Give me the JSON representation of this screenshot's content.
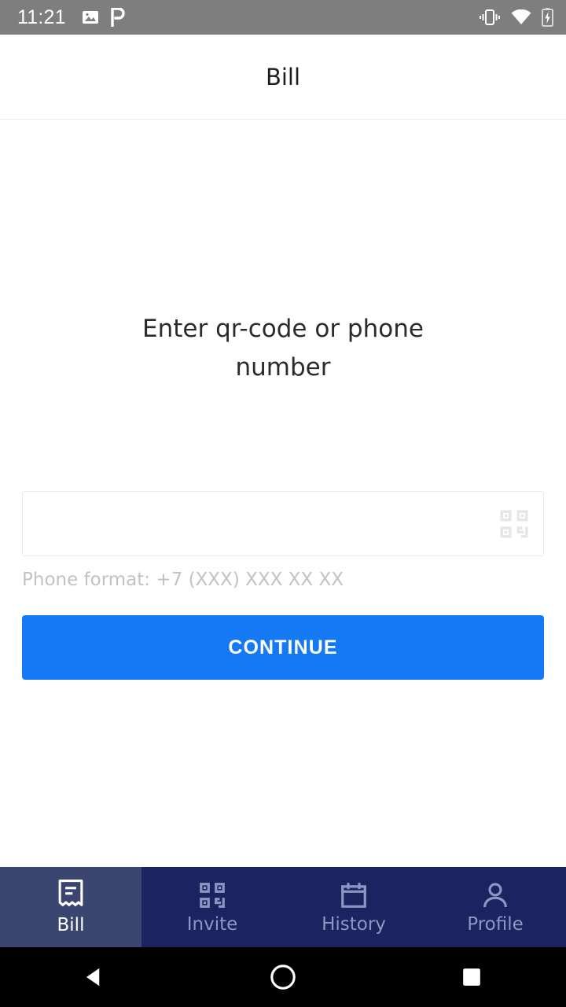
{
  "status_bar": {
    "time": "11:21",
    "left_icons": [
      {
        "name": "photo-icon"
      },
      {
        "name": "pocket-casts-icon"
      }
    ],
    "right_icons": [
      {
        "name": "vibrate-icon"
      },
      {
        "name": "wifi-icon"
      },
      {
        "name": "battery-charging-icon"
      }
    ],
    "background_color": "#7e7e7e"
  },
  "header": {
    "title": "Bill"
  },
  "main": {
    "prompt": "Enter qr-code or phone number",
    "input": {
      "value": "",
      "placeholder": "",
      "qr_icon": "qr-code-scan-icon"
    },
    "hint": "Phone format: +7 (XXX) XXX XX XX",
    "continue_label": "CONTINUE",
    "accent_color": "#1479f2"
  },
  "tab_bar": {
    "active_index": 0,
    "active_background": "#3a4570",
    "background": "#1b2461",
    "items": [
      {
        "label": "Bill",
        "icon": "receipt-icon",
        "active": true
      },
      {
        "label": "Invite",
        "icon": "qr-code-icon",
        "active": false
      },
      {
        "label": "History",
        "icon": "calendar-icon",
        "active": false
      },
      {
        "label": "Profile",
        "icon": "person-icon",
        "active": false
      }
    ]
  },
  "android_nav": {
    "back": "back-triangle-icon",
    "home": "home-circle-icon",
    "recents": "recents-square-icon"
  }
}
